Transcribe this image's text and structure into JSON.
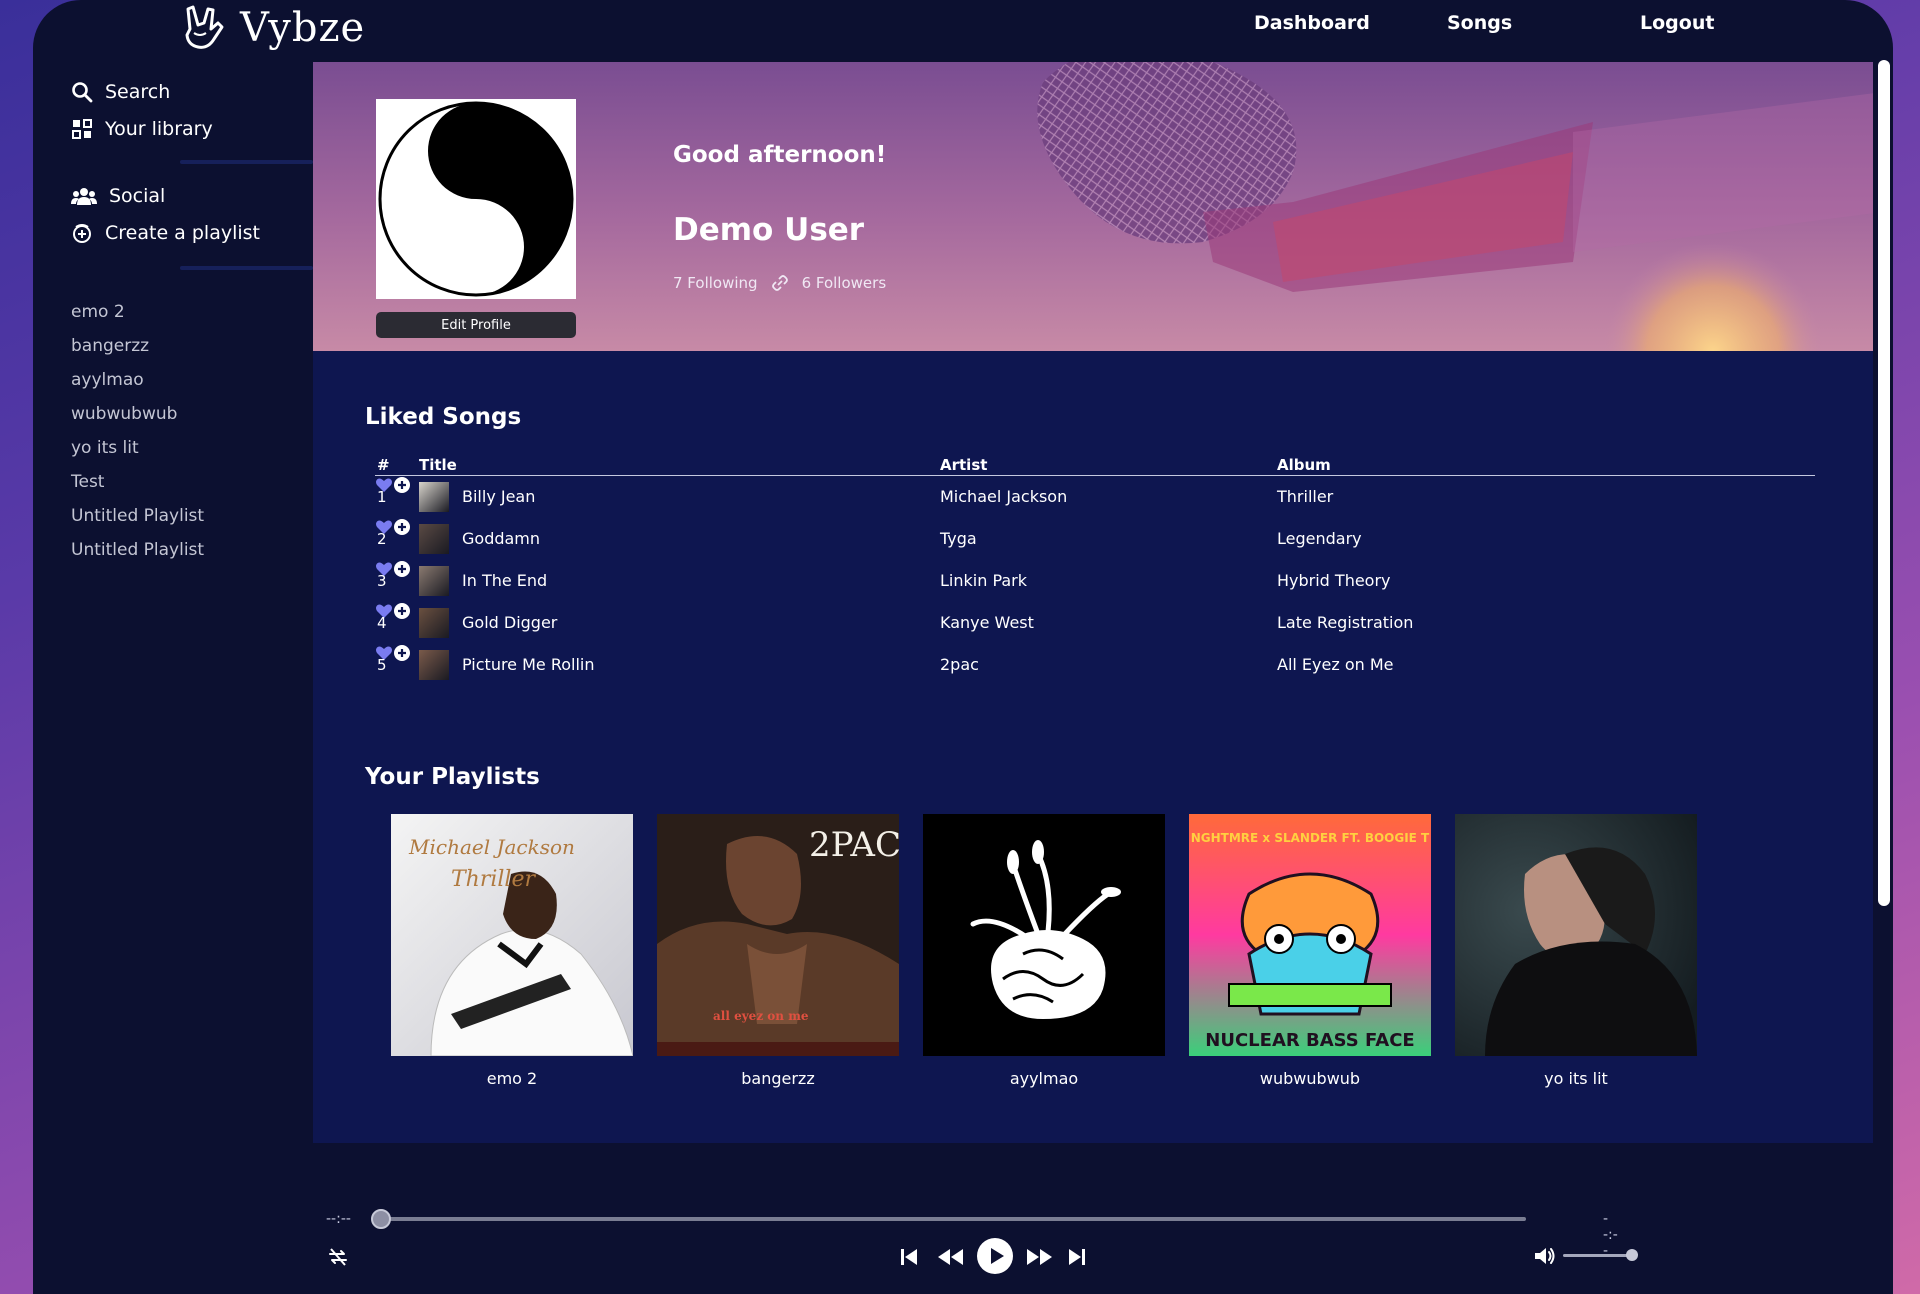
{
  "brand": {
    "name": "Vybze"
  },
  "nav": {
    "dashboard": "Dashboard",
    "songs": "Songs",
    "logout": "Logout"
  },
  "sidebar": {
    "search": "Search",
    "library": "Your library",
    "social": "Social",
    "create_playlist": "Create a playlist",
    "playlists": [
      "emo 2",
      "bangerzz",
      "ayylmao",
      "wubwubwub",
      "yo its lit",
      "Test",
      "Untitled Playlist",
      "Untitled Playlist"
    ]
  },
  "profile": {
    "greeting": "Good afternoon!",
    "username": "Demo User",
    "following": "7 Following",
    "followers": "6 Followers",
    "edit_button": "Edit Profile"
  },
  "liked": {
    "title": "Liked Songs",
    "columns": {
      "num": "#",
      "title": "Title",
      "artist": "Artist",
      "album": "Album"
    },
    "rows": [
      {
        "num": "1",
        "title": "Billy Jean",
        "artist": "Michael Jackson",
        "album": "Thriller",
        "thumb_color": "#d8d4cc"
      },
      {
        "num": "2",
        "title": "Goddamn",
        "artist": "Tyga",
        "album": "Legendary",
        "thumb_color": "#5a4a44"
      },
      {
        "num": "3",
        "title": "In The End",
        "artist": "Linkin Park",
        "album": "Hybrid Theory",
        "thumb_color": "#8a7a70"
      },
      {
        "num": "4",
        "title": "Gold Digger",
        "artist": "Kanye West",
        "album": "Late Registration",
        "thumb_color": "#6a5040"
      },
      {
        "num": "5",
        "title": "Picture Me Rollin",
        "artist": "2pac",
        "album": "All Eyez on Me",
        "thumb_color": "#7a5a4a"
      }
    ]
  },
  "playlists_section": {
    "title": "Your Playlists",
    "items": [
      {
        "name": "emo 2",
        "cover": "thriller",
        "cover_title": "Michael Jackson",
        "cover_sub": "Thriller"
      },
      {
        "name": "bangerzz",
        "cover": "2pac",
        "cover_title": "2PAC",
        "cover_sub": "all eyez on me"
      },
      {
        "name": "ayylmao",
        "cover": "brain"
      },
      {
        "name": "wubwubwub",
        "cover": "nuclear",
        "cover_title": "NGHTMRE x SLANDER FT. BOOGIE T",
        "cover_sub": "NUCLEAR BASS FACE"
      },
      {
        "name": "yo its lit",
        "cover": "portrait"
      }
    ]
  },
  "player": {
    "current_time": "--:--",
    "total_time": "--:--",
    "progress": 0,
    "volume": 0.9
  },
  "colors": {
    "accent": "#7a7cf0",
    "main_bg": "#0e1650",
    "app_bg": "#0c1030"
  }
}
